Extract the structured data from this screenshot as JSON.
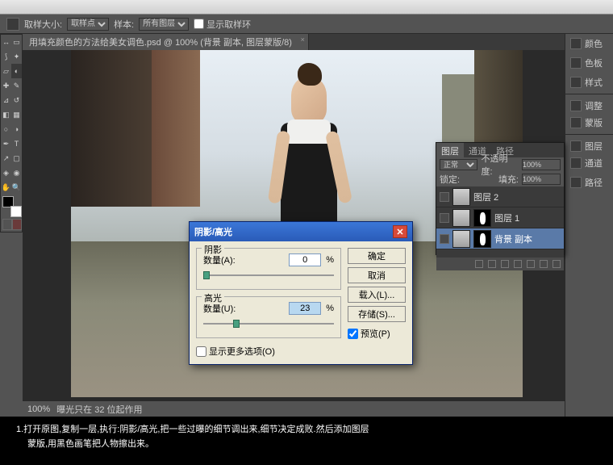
{
  "optbar": {
    "label1": "取样大小:",
    "sel1": "取样点",
    "label2": "样本:",
    "sel2": "所有图层",
    "chk": "显示取样环"
  },
  "tab": {
    "title": "用填充颜色的方法给美女调色.psd @ 100% (背景 副本, 图层蒙版/8)"
  },
  "status": {
    "zoom": "100%",
    "msg": "曝光只在 32 位起作用"
  },
  "rside": {
    "i1": "颜色",
    "i2": "色板",
    "i3": "样式",
    "i4": "调整",
    "i5": "蒙版",
    "i6": "图层",
    "i7": "通道",
    "i8": "路径"
  },
  "layers": {
    "t1": "图层",
    "t2": "通道",
    "t3": "路径",
    "blend": "正常",
    "opLbl": "不透明度:",
    "op": "100%",
    "lockLbl": "锁定:",
    "fillLbl": "填充:",
    "fill": "100%",
    "l1": "图层 2",
    "l2": "图层 1",
    "l3": "背景 副本"
  },
  "dialog": {
    "title": "阴影/高光",
    "g1": "阴影",
    "g2": "高光",
    "amtA": "数量(A):",
    "amtU": "数量(U):",
    "v1": "0",
    "v2": "23",
    "pct": "%",
    "more": "显示更多选项(O)",
    "ok": "确定",
    "cancel": "取消",
    "load": "载入(L)...",
    "save": "存储(S)...",
    "preview": "预览(P)"
  },
  "caption": {
    "line1": "1.打开原图,复制一层,执行:阴影/高光,把一些过曝的细节调出来,细节决定成败.然后添加图层",
    "line2": "蒙版,用黑色画笔把人物擦出来。"
  }
}
